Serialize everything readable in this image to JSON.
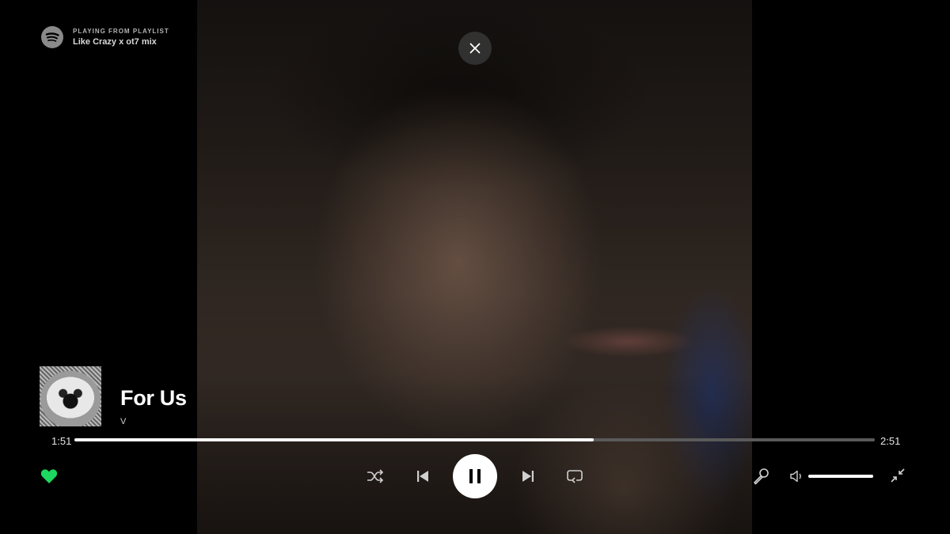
{
  "colors": {
    "accent": "#1ed760",
    "background": "#000000",
    "progress_bg": "#5a5a5a",
    "text": "#ffffff"
  },
  "header": {
    "source_label": "PLAYING FROM PLAYLIST",
    "playlist_name": "Like Crazy x ot7 mix",
    "logo_icon": "spotify-icon"
  },
  "close_icon": "close-icon",
  "track": {
    "title": "For Us",
    "artist": "V",
    "liked": true
  },
  "playback": {
    "elapsed": "1:51",
    "duration": "2:51",
    "progress_fraction": 0.649,
    "state": "playing"
  },
  "controls": {
    "left": [
      "heart-icon"
    ],
    "center": [
      "shuffle-icon",
      "previous-icon",
      "pause-icon",
      "next-icon",
      "repeat-icon"
    ],
    "right": [
      "microphone-icon",
      "volume-icon",
      "minimize-icon"
    ]
  },
  "volume": {
    "level_fraction": 1.0
  }
}
